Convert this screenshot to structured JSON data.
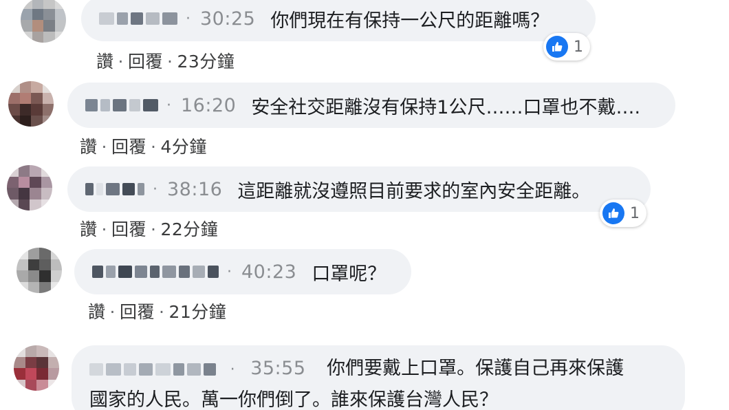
{
  "comments": [
    {
      "timestamp": "30:25",
      "text": "你們現在有保持一公尺的距離嗎？",
      "like": "讚",
      "reply": "回覆",
      "age": "23分鐘",
      "reaction_count": "1"
    },
    {
      "timestamp": "16:20",
      "text": "安全社交距離沒有保持1公尺……口罩也不戴….",
      "like": "讚",
      "reply": "回覆",
      "age": "4分鐘"
    },
    {
      "timestamp": "38:16",
      "text": "這距離就沒遵照目前要求的室內安全距離。",
      "like": "讚",
      "reply": "回覆",
      "age": "22分鐘",
      "reaction_count": "1"
    },
    {
      "timestamp": "40:23",
      "text": "口罩呢？",
      "like": "讚",
      "reply": "回覆",
      "age": "21分鐘"
    },
    {
      "timestamp": "35:55",
      "text_line1": "你們要戴上口罩。保護自己再來保護",
      "text_line2": "國家的人民。萬一你們倒了。誰來保護台灣人民？"
    }
  ],
  "separator": "·",
  "colors": {
    "bubble": "#f0f2f5",
    "timestamp": "#8a8d91",
    "like_blue": "#1877f2"
  }
}
